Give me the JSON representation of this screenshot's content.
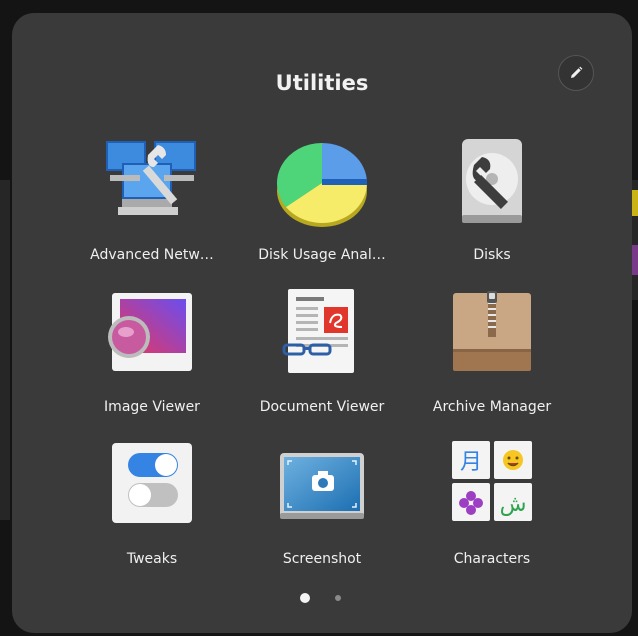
{
  "folder": {
    "title": "Utilities",
    "edit_icon": "pencil-icon"
  },
  "apps": [
    {
      "label": "Advanced Netw…",
      "icon": "network-computers-wrench-icon"
    },
    {
      "label": "Disk Usage Anal…",
      "icon": "pie-chart-icon"
    },
    {
      "label": "Disks",
      "icon": "hard-disk-wrench-icon"
    },
    {
      "label": "Image Viewer",
      "icon": "image-viewer-icon"
    },
    {
      "label": "Document Viewer",
      "icon": "document-glasses-icon"
    },
    {
      "label": "Archive Manager",
      "icon": "archive-box-icon"
    },
    {
      "label": "Tweaks",
      "icon": "toggle-switches-icon"
    },
    {
      "label": "Screenshot",
      "icon": "camera-screen-icon"
    },
    {
      "label": "Characters",
      "icon": "characters-grid-icon"
    }
  ],
  "pager": {
    "pages": 2,
    "current": 1
  },
  "colors": {
    "folder_bg": "#3a3a3a",
    "text": "#f0f0f0"
  }
}
